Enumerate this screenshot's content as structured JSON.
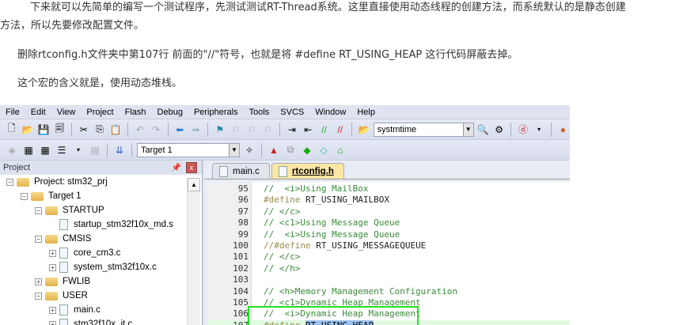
{
  "article": {
    "p1a": "下来就可以先简单的编写一个测试程序，先测试测试RT-Thread系统。这里直接使用动态线程的创建方法，而系统默认的是静态创建",
    "p1b": "方法，所以先要修改配置文件。",
    "p2": "删除rtconfig.h文件夹中第107行 前面的\"//\"符号，也就是将 #define RT_USING_HEAP 这行代码屏蔽去掉。",
    "p3": "这个宏的含义就是，使用动态堆栈。"
  },
  "ide": {
    "menu": [
      "File",
      "Edit",
      "View",
      "Project",
      "Flash",
      "Debug",
      "Peripherals",
      "Tools",
      "SVCS",
      "Window",
      "Help"
    ],
    "find_combo": "systmtime",
    "target_combo": "Target 1",
    "project_panel": {
      "title": "Project",
      "tree": [
        {
          "label": "Project: stm32_prj",
          "level": 0,
          "exp": "−",
          "kind": "proj"
        },
        {
          "label": "Target 1",
          "level": 1,
          "exp": "−",
          "kind": "folder"
        },
        {
          "label": "STARTUP",
          "level": 2,
          "exp": "−",
          "kind": "folder"
        },
        {
          "label": "startup_stm32f10x_md.s",
          "level": 3,
          "exp": "",
          "kind": "file"
        },
        {
          "label": "CMSIS",
          "level": 2,
          "exp": "−",
          "kind": "folder"
        },
        {
          "label": "core_cm3.c",
          "level": 3,
          "exp": "+",
          "kind": "file"
        },
        {
          "label": "system_stm32f10x.c",
          "level": 3,
          "exp": "+",
          "kind": "file"
        },
        {
          "label": "FWLIB",
          "level": 2,
          "exp": "+",
          "kind": "folder"
        },
        {
          "label": "USER",
          "level": 2,
          "exp": "−",
          "kind": "folder"
        },
        {
          "label": "main.c",
          "level": 3,
          "exp": "+",
          "kind": "file"
        },
        {
          "label": "stm32f10x_it.c",
          "level": 3,
          "exp": "+",
          "kind": "file"
        }
      ]
    },
    "tabs": [
      "main.c",
      "rtconfig.h"
    ],
    "active_tab": 1,
    "code": [
      {
        "n": "95",
        "t": "//  <i>Using MailBox"
      },
      {
        "n": "96",
        "kw": "#define",
        "id": "RT_USING_MAILBOX"
      },
      {
        "n": "97",
        "t": "// </c>"
      },
      {
        "n": "98",
        "t": "// <c1>Using Message Queue"
      },
      {
        "n": "99",
        "t": "//  <i>Using Message Queue"
      },
      {
        "n": "100",
        "kw": "//#define",
        "id": "RT_USING_MESSAGEQUEUE"
      },
      {
        "n": "101",
        "t": "// </c>"
      },
      {
        "n": "102",
        "t": "// </h>"
      },
      {
        "n": "103",
        "t": ""
      },
      {
        "n": "104",
        "t": "// <h>Memory Management Configuration"
      },
      {
        "n": "105",
        "t": "// <c1>Dynamic Heap Management"
      },
      {
        "n": "106",
        "t": "//  <i>Dynamic Heap Management"
      },
      {
        "n": "107",
        "kw": "#define",
        "id": "RT_USING_HEAP",
        "selected": true
      }
    ]
  }
}
